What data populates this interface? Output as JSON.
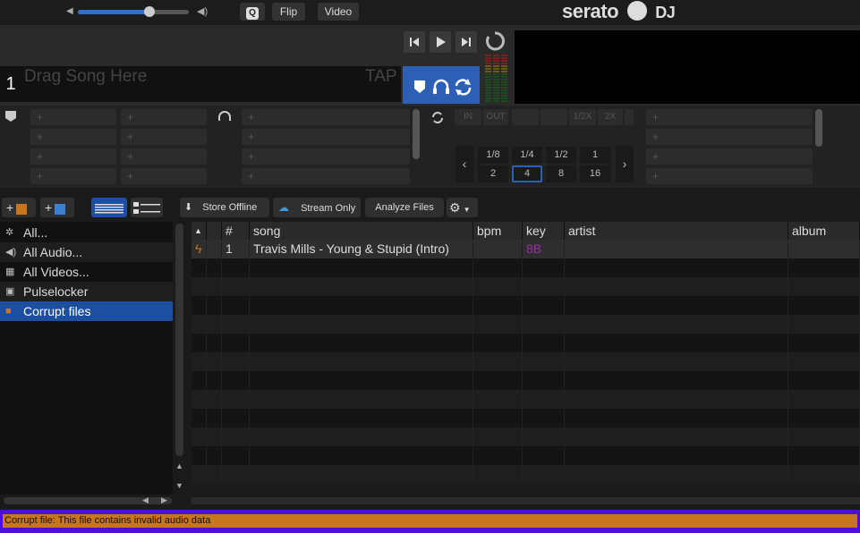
{
  "topbar": {
    "volume_level": 0.62,
    "buttons": {
      "q": "Q",
      "flip": "Flip",
      "video": "Video"
    },
    "logo": "serato",
    "logo_suffix": "DJ"
  },
  "deck": {
    "number": "1",
    "drag_text": "Drag Song Here",
    "tap_label": "TAP"
  },
  "loop": {
    "in_label": "IN",
    "out_label": "OUT",
    "half_label": "1/2X",
    "double_label": "2X",
    "sizes_top": [
      "1/8",
      "1/4",
      "1/2",
      "1"
    ],
    "sizes_bottom": [
      "2",
      "4",
      "8",
      "16"
    ],
    "selected": "4"
  },
  "cue_pad_label": "+",
  "toolbar": {
    "store_offline": "Store Offline",
    "stream_only": "Stream Only",
    "analyze_files": "Analyze Files"
  },
  "sidebar": {
    "items": [
      {
        "label": "All...",
        "icon": "asterisk-icon"
      },
      {
        "label": "All Audio...",
        "icon": "speaker-icon"
      },
      {
        "label": "All Videos...",
        "icon": "film-icon"
      },
      {
        "label": "Pulselocker",
        "icon": "pulselocker-icon"
      },
      {
        "label": "Corrupt files",
        "icon": "crate-icon"
      }
    ]
  },
  "table": {
    "columns": [
      "#",
      "song",
      "bpm",
      "key",
      "artist",
      "album"
    ],
    "rows": [
      {
        "num": "1",
        "song": "Travis Mills - Young & Stupid (Intro)",
        "bpm": "",
        "key": "8B",
        "artist": "",
        "album": ""
      }
    ]
  },
  "status": {
    "message": "Corrupt file: This file contains invalid audio data"
  },
  "colors": {
    "accent_blue": "#2d5fb5",
    "status_bg": "#4b0fd6",
    "status_inner": "#c8761c",
    "key_color": "#9b2fa8"
  }
}
